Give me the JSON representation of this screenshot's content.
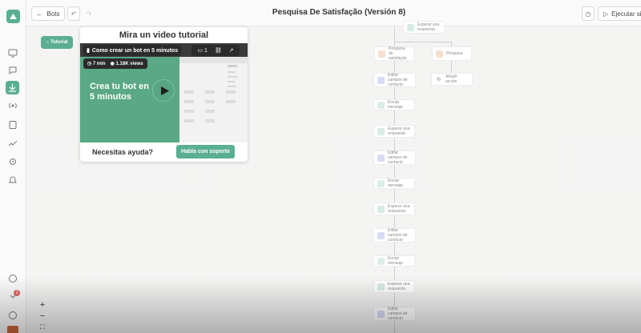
{
  "header": {
    "back_label": "Bots",
    "title": "Pesquisa De Satisfação (Versión 8)",
    "run_label": "Ejecutar sin"
  },
  "sidebar": {
    "icons": [
      "logo-icon",
      "monitor-icon",
      "chat-icon",
      "bot-icon",
      "broadcast-icon",
      "book-icon",
      "trend-icon",
      "settings-icon",
      "bell-icon",
      "whatsapp-icon",
      "notifications-icon",
      "help-icon",
      "avatar"
    ],
    "notification_count": "1"
  },
  "tutorial": {
    "chip_label": "Tutorial",
    "card_title": "Mira un video tutorial",
    "video_title": "Como crear un bot en 5 minutos",
    "comments": "1",
    "duration": "7 min",
    "views": "1.18K views",
    "headline": "Crea tu bot en 5 minutos",
    "help_text": "Necesitas ayuda?",
    "support_button": "Habla con soporte"
  },
  "flow": {
    "nodes": [
      "Esperar una respuesta",
      "Pesquisa de satisfação",
      "Pesquisa",
      "Editar campos de contacto",
      "Añadir acción",
      "Enviar mensaje",
      "Esperar una respuesta",
      "Editar campos de contacto",
      "Enviar mensaje",
      "Esperar una respuesta",
      "Editar campos de contacto",
      "Enviar mensaje",
      "Esperar una respuesta",
      "Editar campos de contacto"
    ]
  },
  "zoom": {
    "in": "+",
    "out": "−",
    "fit": "⛶"
  },
  "colors": {
    "accent": "#5aae93",
    "canvas": "#f4f4f3"
  }
}
